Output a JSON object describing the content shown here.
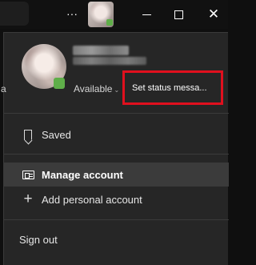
{
  "titlebar": {
    "more_glyph": "···",
    "minimize_icon": "minimize-icon",
    "maximize_icon": "maximize-icon",
    "close_glyph": "✕"
  },
  "profile": {
    "edge_text": "a",
    "presence_label": "Available",
    "presence_chevron": "⌄",
    "status_message_label": "Set status messa..."
  },
  "menu": {
    "saved_label": "Saved",
    "manage_account_label": "Manage account",
    "add_account_label": "Add personal account",
    "plus_glyph": "+",
    "sign_out_label": "Sign out"
  },
  "colors": {
    "highlight": "#e0101e",
    "available_green": "#5fae49",
    "panel_bg": "#262626",
    "selected_row_bg": "#3b3b3b"
  }
}
